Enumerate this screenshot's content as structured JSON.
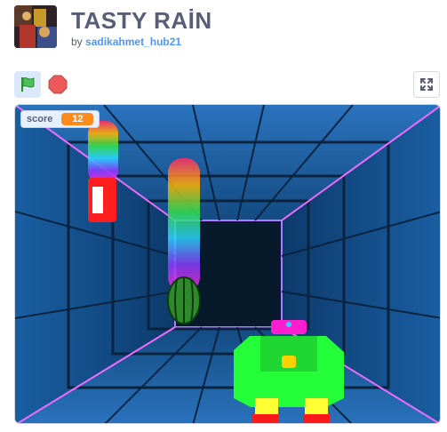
{
  "project": {
    "title": "TASTY RAİN",
    "by_label": "by",
    "author": "sadikahmet_hub21"
  },
  "controls": {
    "green_flag_icon": "green-flag-icon",
    "stop_icon": "stop-sign-icon",
    "fullscreen_icon": "fullscreen-icon"
  },
  "stage": {
    "score_label": "score",
    "score_value": "12"
  },
  "colors": {
    "title": "#575e75",
    "author_link": "#4c97ff",
    "monitor_value": "#ff8c1a"
  }
}
